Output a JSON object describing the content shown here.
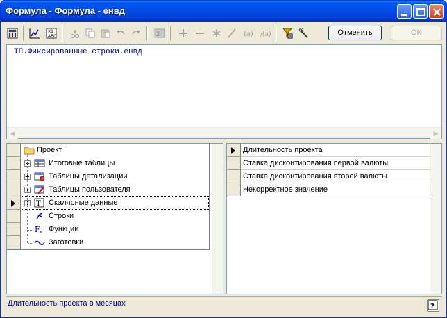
{
  "window": {
    "title": "Формула - Формула - енвд"
  },
  "toolbar": {
    "icons": [
      "calculator-icon",
      "chart-icon",
      "variables-icon",
      "cut-icon",
      "copy-icon",
      "paste-icon",
      "undo-icon",
      "redo-icon",
      "formula-icon",
      "plus-icon",
      "minus-icon",
      "multiply-icon",
      "divide-icon",
      "brackets-icon",
      "divide-brackets-icon",
      "filter-icon",
      "wrench-icon"
    ],
    "cancel_label": "Отменить",
    "ok_label": "OK"
  },
  "editor": {
    "formula": "ТП.Фиксированные строки.енвд"
  },
  "tree": {
    "items": [
      {
        "label": "Проект",
        "icon": "folder-icon"
      },
      {
        "label": "Итоговые таблицы",
        "icon": "table-icon"
      },
      {
        "label": "Таблицы детализации",
        "icon": "detail-table-icon"
      },
      {
        "label": "Таблицы пользователя",
        "icon": "user-table-icon"
      },
      {
        "label": "Скалярные данные",
        "icon": "scalar-icon"
      },
      {
        "label": "Строки",
        "icon": "string-icon"
      },
      {
        "label": "Функции",
        "icon": "function-icon"
      },
      {
        "label": "Заготовки",
        "icon": "template-icon"
      }
    ]
  },
  "list": {
    "items": [
      {
        "label": "Длительность проекта"
      },
      {
        "label": "Ставка дисконтирования первой валюты"
      },
      {
        "label": "Ставка дисконтирования второй валюты"
      },
      {
        "label": "Некорректное значение"
      }
    ]
  },
  "status": {
    "text": "Длительность проекта в месяцах"
  },
  "colors": {
    "title_bar": "#0053ee",
    "formula_text": "#0000a0",
    "status_text": "#0000a0"
  }
}
